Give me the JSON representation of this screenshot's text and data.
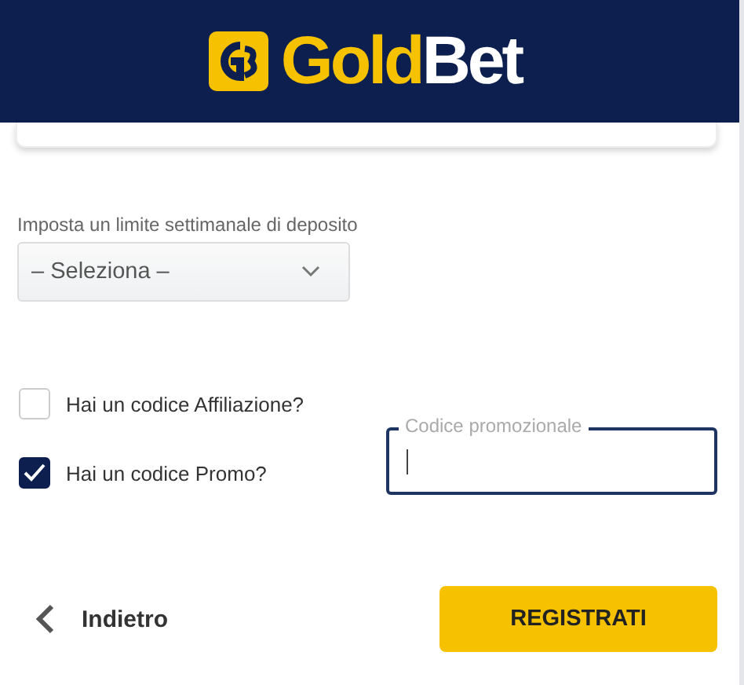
{
  "header": {
    "logo": {
      "primary": "Gold",
      "secondary": "Bet"
    }
  },
  "deposit_limit": {
    "label": "Imposta un limite settimanale di deposito",
    "value": "– Seleziona –"
  },
  "options": [
    {
      "label": "Hai un codice Affiliazione?",
      "checked": false
    },
    {
      "label": "Hai un codice Promo?",
      "checked": true
    }
  ],
  "promo_field": {
    "label": "Codice promozionale",
    "focused": true
  },
  "footer": {
    "back": "Indietro",
    "submit": "REGISTRATI"
  }
}
